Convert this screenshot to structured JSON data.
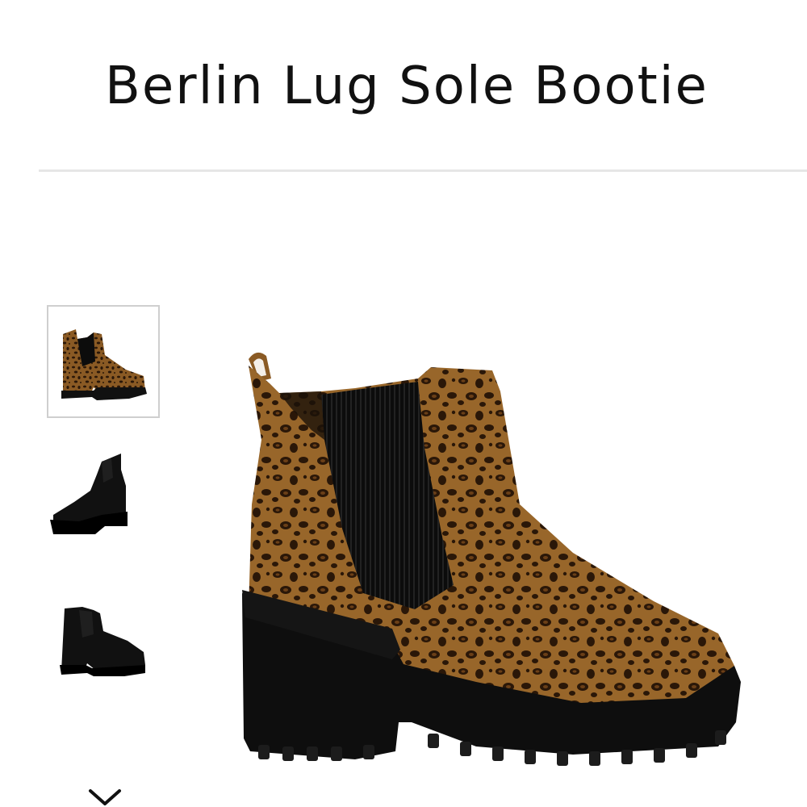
{
  "product": {
    "title": "Berlin Lug Sole Bootie"
  },
  "gallery": {
    "thumbnails": [
      {
        "variant": "leopard",
        "selected": true
      },
      {
        "variant": "black",
        "selected": false
      },
      {
        "variant": "black",
        "selected": false
      }
    ],
    "scroll_icon": "chevron-down-icon",
    "main_variant": "leopard"
  },
  "colors": {
    "leopard_base": "#8a5a24",
    "leopard_spot": "#2a1708",
    "boot_black": "#111111",
    "divider": "#e6e6e6",
    "thumb_border": "#cfcfcf"
  }
}
